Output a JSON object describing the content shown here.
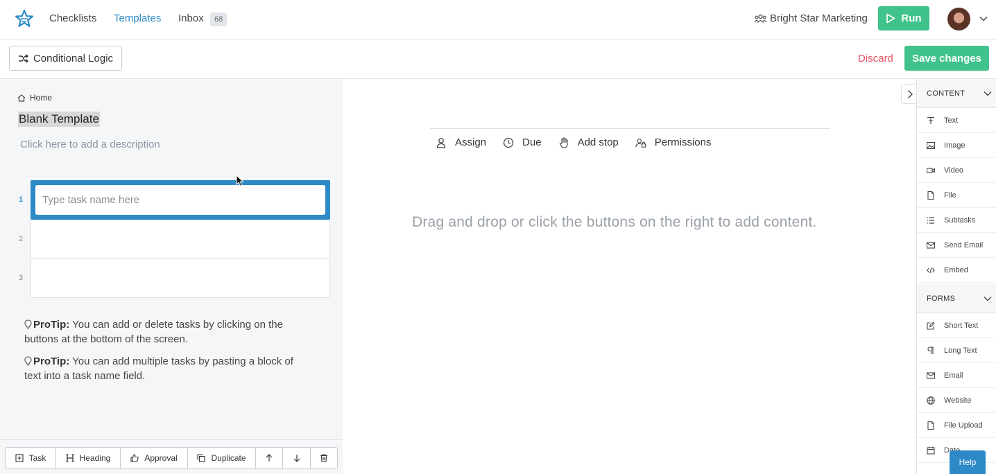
{
  "nav": {
    "links": [
      "Checklists",
      "Templates",
      "Inbox"
    ],
    "inbox_count": "68",
    "org_name": "Bright Star Marketing",
    "run_label": "Run"
  },
  "toolbar": {
    "conditional_logic_label": "Conditional Logic",
    "discard_label": "Discard",
    "save_label": "Save changes"
  },
  "template": {
    "breadcrumb": "Home",
    "title": "Blank Template",
    "description_placeholder": "Click here to add a description",
    "task_numbers": [
      "1",
      "2",
      "3"
    ],
    "task_input_placeholder": "Type task name here",
    "protips": [
      {
        "label": "ProTip:",
        "text": " You can add or delete tasks by clicking on the buttons at the bottom of the screen."
      },
      {
        "label": "ProTip:",
        "text": " You can add multiple tasks by pasting a block of text into a task name field."
      }
    ]
  },
  "bottom_bar": {
    "task": "Task",
    "heading": "Heading",
    "approval": "Approval",
    "duplicate": "Duplicate"
  },
  "main": {
    "actions": [
      "Assign",
      "Due",
      "Add stop",
      "Permissions"
    ],
    "empty_message": "Drag and drop or click the buttons on the right to add content."
  },
  "sidebar": {
    "content_header": "CONTENT",
    "content_items": [
      "Text",
      "Image",
      "Video",
      "File",
      "Subtasks",
      "Send Email",
      "Embed"
    ],
    "forms_header": "FORMS",
    "forms_items": [
      "Short Text",
      "Long Text",
      "Email",
      "Website",
      "File Upload",
      "Date"
    ]
  },
  "help_label": "Help",
  "colors": {
    "accent_blue": "#2d8ac7",
    "success_green": "#3fc28b",
    "danger_red": "#e0525e"
  }
}
